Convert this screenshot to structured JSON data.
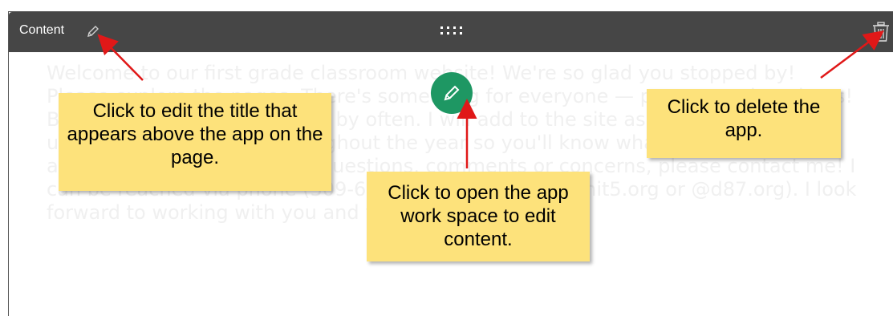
{
  "app": {
    "title": "Content",
    "edit_title_icon": "pencil-icon",
    "drag_handle_icon": "drag-dots-icon",
    "delete_icon": "trash-icon",
    "edit_content_icon": "pencil-icon",
    "body_text": "Welcome to our first grade classroom website!  We're so glad you stopped by!  Please explore the pages.  There's something for everyone — parents and students!  Bookmark this page and stop by often.  I will add to the site as time permits and update the home page throughout the year so you'll know what we're learning about!  If you ever have any questions, comments or concerns, please contact me!  I can be reached via phone (309-662-4302) or email (@unit5.org or @d87.org).  I look forward to working with you and your child this year!"
  },
  "callouts": {
    "edit_title": "Click to edit the title that appears above the app on the page.",
    "open_workspace": "Click to open the app work space to edit content.",
    "delete_app": "Click to delete the app."
  },
  "colors": {
    "header_bg": "#464646",
    "fab_bg": "#1e9763",
    "callout_bg": "#fde27b",
    "arrow": "#e01818"
  }
}
